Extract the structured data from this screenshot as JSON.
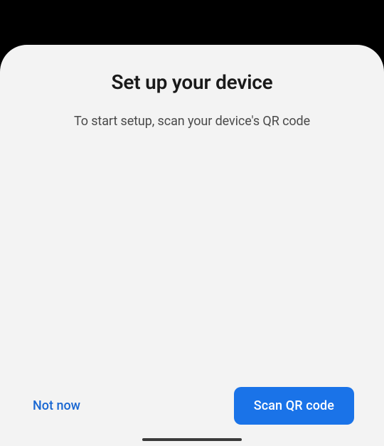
{
  "dialog": {
    "title": "Set up your device",
    "subtitle": "To start setup, scan your device's QR code"
  },
  "actions": {
    "secondary_label": "Not now",
    "primary_label": "Scan QR code"
  }
}
